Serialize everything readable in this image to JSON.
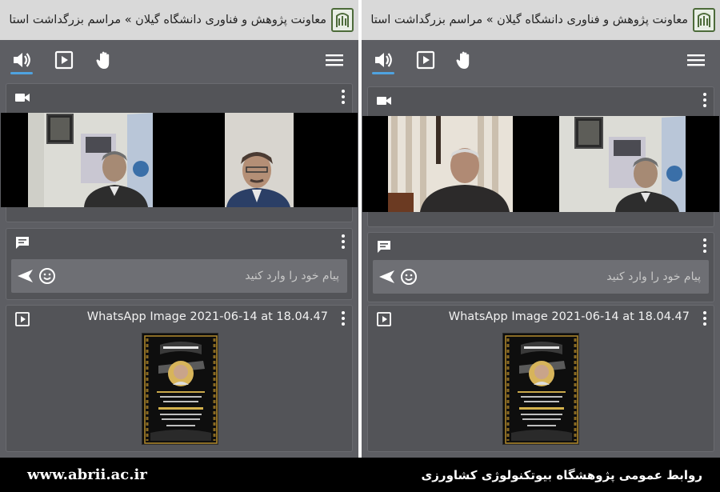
{
  "meeting_title": "معاونت پژوهش و فناوری دانشگاه گیلان » مراسم بزرگداشت استا",
  "chat_placeholder": "پیام خود را وارد کنید",
  "shared_file_name": "WhatsApp Image 2021-06-14 at 18.04.47",
  "icons": {
    "toolbar": [
      "speaker-icon",
      "play-square-icon",
      "raised-hand-icon",
      "hamburger-menu-icon"
    ],
    "cards": [
      "video-camera-icon",
      "chat-icon",
      "media-play-icon",
      "kebab-menu-icon"
    ],
    "chat": [
      "send-icon",
      "emoji-icon"
    ]
  },
  "colors": {
    "app_background": "#5d5e63",
    "title_bar": "#d9d9d9",
    "active_underline": "#4fa3e0",
    "footer_background": "#000000"
  },
  "footer": {
    "url": "www.abrii.ac.ir",
    "org": "روابط عمومی پژوهشگاه بیوتکنولوژی کشاورزی"
  }
}
